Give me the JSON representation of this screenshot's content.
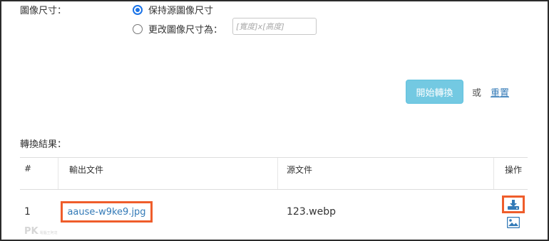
{
  "image_size": {
    "label": "圖像尺寸：",
    "options": [
      {
        "label": "保持源圖像尺寸",
        "selected": true
      },
      {
        "label": "更改圖像尺寸為：",
        "selected": false
      }
    ],
    "input_placeholder": "[寬度]x[高度]"
  },
  "actions": {
    "convert_label": "開始轉換",
    "or_text": "或",
    "reset_label": "重置"
  },
  "results": {
    "label": "轉換結果：",
    "columns": [
      "#",
      "輸出文件",
      "源文件",
      "操作"
    ],
    "rows": [
      {
        "index": "1",
        "output_file": "aause-w9ke9.jpg",
        "source_file": "123.webp",
        "actions": [
          "download-icon",
          "image-icon"
        ]
      }
    ]
  },
  "watermark": {
    "text": "PK",
    "small_text": "電腦王阿達"
  },
  "colors": {
    "accent": "#5bc0de",
    "link": "#337ab7",
    "highlight": "#ef5d2b",
    "radio": "#1a73e8"
  }
}
